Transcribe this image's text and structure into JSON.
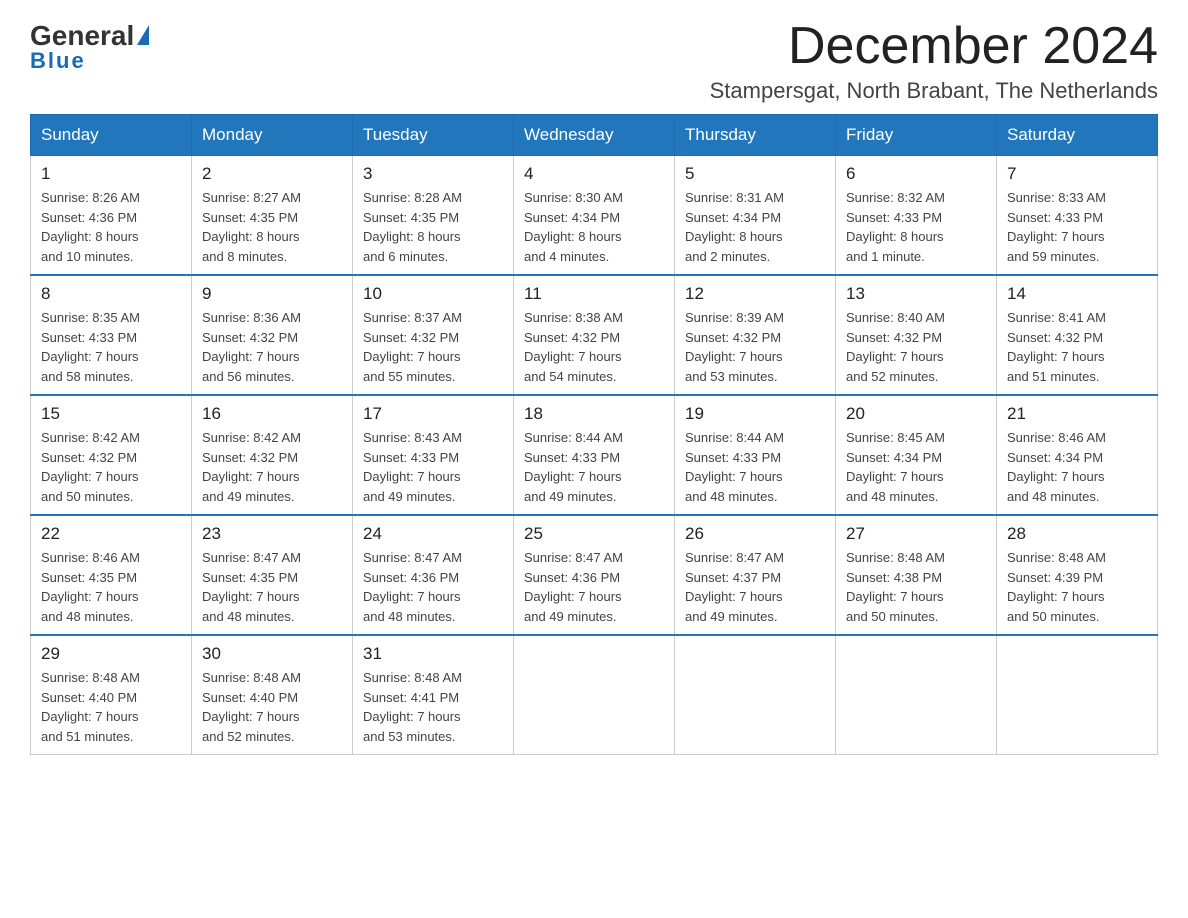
{
  "header": {
    "logo_text_general": "General",
    "logo_text_blue": "Blue",
    "month_title": "December 2024",
    "location": "Stampersgat, North Brabant, The Netherlands"
  },
  "weekdays": [
    "Sunday",
    "Monday",
    "Tuesday",
    "Wednesday",
    "Thursday",
    "Friday",
    "Saturday"
  ],
  "weeks": [
    [
      {
        "day": "1",
        "sunrise": "8:26 AM",
        "sunset": "4:36 PM",
        "daylight": "8 hours and 10 minutes."
      },
      {
        "day": "2",
        "sunrise": "8:27 AM",
        "sunset": "4:35 PM",
        "daylight": "8 hours and 8 minutes."
      },
      {
        "day": "3",
        "sunrise": "8:28 AM",
        "sunset": "4:35 PM",
        "daylight": "8 hours and 6 minutes."
      },
      {
        "day": "4",
        "sunrise": "8:30 AM",
        "sunset": "4:34 PM",
        "daylight": "8 hours and 4 minutes."
      },
      {
        "day": "5",
        "sunrise": "8:31 AM",
        "sunset": "4:34 PM",
        "daylight": "8 hours and 2 minutes."
      },
      {
        "day": "6",
        "sunrise": "8:32 AM",
        "sunset": "4:33 PM",
        "daylight": "8 hours and 1 minute."
      },
      {
        "day": "7",
        "sunrise": "8:33 AM",
        "sunset": "4:33 PM",
        "daylight": "7 hours and 59 minutes."
      }
    ],
    [
      {
        "day": "8",
        "sunrise": "8:35 AM",
        "sunset": "4:33 PM",
        "daylight": "7 hours and 58 minutes."
      },
      {
        "day": "9",
        "sunrise": "8:36 AM",
        "sunset": "4:32 PM",
        "daylight": "7 hours and 56 minutes."
      },
      {
        "day": "10",
        "sunrise": "8:37 AM",
        "sunset": "4:32 PM",
        "daylight": "7 hours and 55 minutes."
      },
      {
        "day": "11",
        "sunrise": "8:38 AM",
        "sunset": "4:32 PM",
        "daylight": "7 hours and 54 minutes."
      },
      {
        "day": "12",
        "sunrise": "8:39 AM",
        "sunset": "4:32 PM",
        "daylight": "7 hours and 53 minutes."
      },
      {
        "day": "13",
        "sunrise": "8:40 AM",
        "sunset": "4:32 PM",
        "daylight": "7 hours and 52 minutes."
      },
      {
        "day": "14",
        "sunrise": "8:41 AM",
        "sunset": "4:32 PM",
        "daylight": "7 hours and 51 minutes."
      }
    ],
    [
      {
        "day": "15",
        "sunrise": "8:42 AM",
        "sunset": "4:32 PM",
        "daylight": "7 hours and 50 minutes."
      },
      {
        "day": "16",
        "sunrise": "8:42 AM",
        "sunset": "4:32 PM",
        "daylight": "7 hours and 49 minutes."
      },
      {
        "day": "17",
        "sunrise": "8:43 AM",
        "sunset": "4:33 PM",
        "daylight": "7 hours and 49 minutes."
      },
      {
        "day": "18",
        "sunrise": "8:44 AM",
        "sunset": "4:33 PM",
        "daylight": "7 hours and 49 minutes."
      },
      {
        "day": "19",
        "sunrise": "8:44 AM",
        "sunset": "4:33 PM",
        "daylight": "7 hours and 48 minutes."
      },
      {
        "day": "20",
        "sunrise": "8:45 AM",
        "sunset": "4:34 PM",
        "daylight": "7 hours and 48 minutes."
      },
      {
        "day": "21",
        "sunrise": "8:46 AM",
        "sunset": "4:34 PM",
        "daylight": "7 hours and 48 minutes."
      }
    ],
    [
      {
        "day": "22",
        "sunrise": "8:46 AM",
        "sunset": "4:35 PM",
        "daylight": "7 hours and 48 minutes."
      },
      {
        "day": "23",
        "sunrise": "8:47 AM",
        "sunset": "4:35 PM",
        "daylight": "7 hours and 48 minutes."
      },
      {
        "day": "24",
        "sunrise": "8:47 AM",
        "sunset": "4:36 PM",
        "daylight": "7 hours and 48 minutes."
      },
      {
        "day": "25",
        "sunrise": "8:47 AM",
        "sunset": "4:36 PM",
        "daylight": "7 hours and 49 minutes."
      },
      {
        "day": "26",
        "sunrise": "8:47 AM",
        "sunset": "4:37 PM",
        "daylight": "7 hours and 49 minutes."
      },
      {
        "day": "27",
        "sunrise": "8:48 AM",
        "sunset": "4:38 PM",
        "daylight": "7 hours and 50 minutes."
      },
      {
        "day": "28",
        "sunrise": "8:48 AM",
        "sunset": "4:39 PM",
        "daylight": "7 hours and 50 minutes."
      }
    ],
    [
      {
        "day": "29",
        "sunrise": "8:48 AM",
        "sunset": "4:40 PM",
        "daylight": "7 hours and 51 minutes."
      },
      {
        "day": "30",
        "sunrise": "8:48 AM",
        "sunset": "4:40 PM",
        "daylight": "7 hours and 52 minutes."
      },
      {
        "day": "31",
        "sunrise": "8:48 AM",
        "sunset": "4:41 PM",
        "daylight": "7 hours and 53 minutes."
      },
      null,
      null,
      null,
      null
    ]
  ],
  "labels": {
    "sunrise": "Sunrise:",
    "sunset": "Sunset:",
    "daylight": "Daylight:"
  },
  "colors": {
    "header_bg": "#2176bc",
    "header_text": "#ffffff",
    "border": "#cccccc",
    "row_separator": "#2176bc"
  }
}
